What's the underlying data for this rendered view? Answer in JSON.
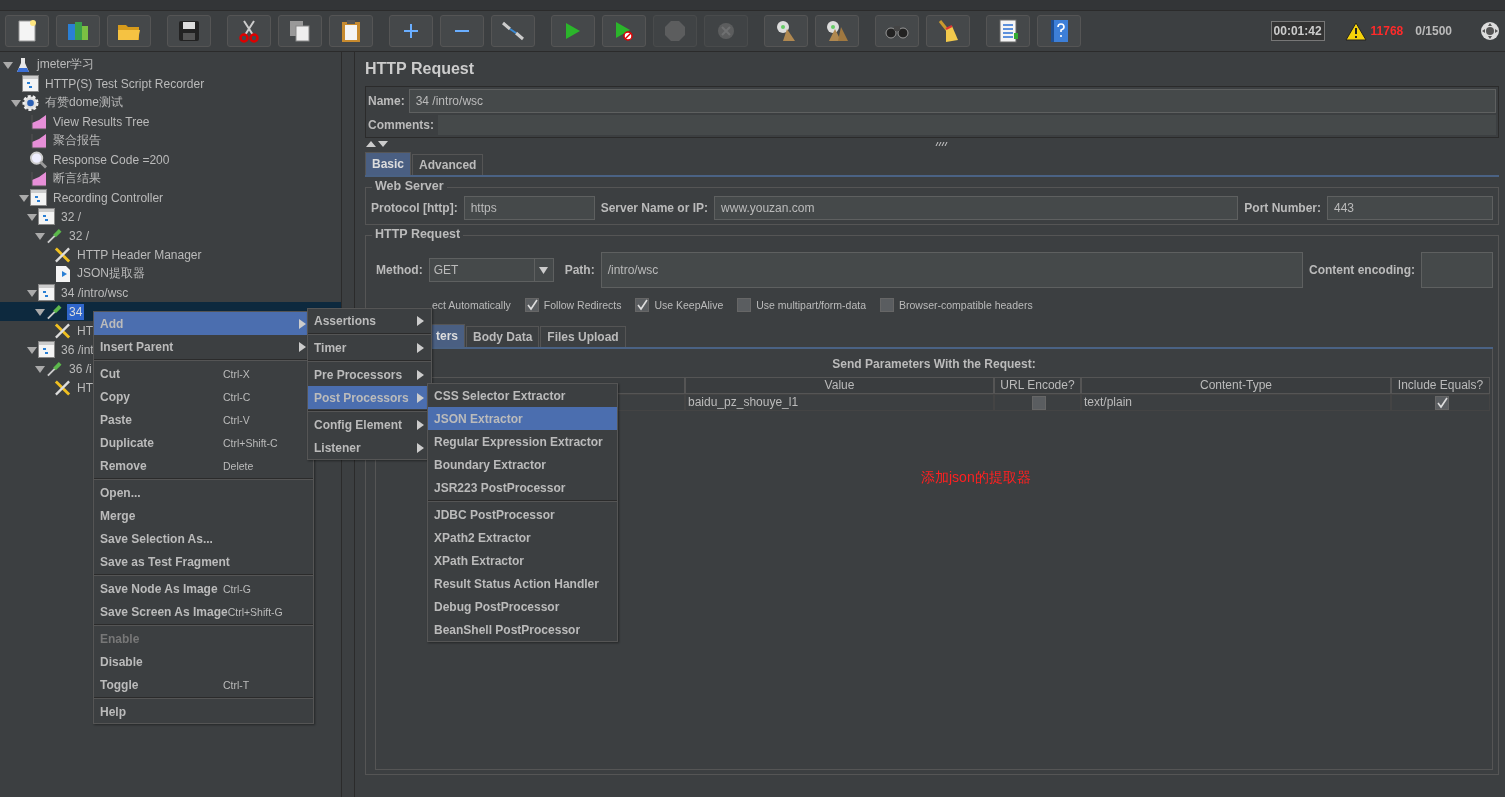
{
  "toolbar": [
    {
      "kind": "new",
      "disabled": false
    },
    {
      "kind": "templates",
      "disabled": false
    },
    {
      "kind": "open",
      "disabled": false
    },
    {
      "kind": "save",
      "disabled": false
    },
    {
      "kind": "cut",
      "disabled": false
    },
    {
      "kind": "copy",
      "disabled": false
    },
    {
      "kind": "paste",
      "disabled": false
    },
    {
      "kind": "add",
      "disabled": false
    },
    {
      "kind": "remove",
      "disabled": false
    },
    {
      "kind": "toggle",
      "disabled": false
    },
    {
      "kind": "start",
      "disabled": false
    },
    {
      "kind": "start_no_pause",
      "disabled": false
    },
    {
      "kind": "stop",
      "disabled": true
    },
    {
      "kind": "shutdown",
      "disabled": true
    },
    {
      "kind": "clear",
      "disabled": false
    },
    {
      "kind": "clear_all",
      "disabled": false
    },
    {
      "kind": "search",
      "disabled": false
    },
    {
      "kind": "reset_search",
      "disabled": false
    },
    {
      "kind": "function_helper",
      "disabled": false
    },
    {
      "kind": "help",
      "disabled": false
    }
  ],
  "status": {
    "timer": "00:01:42",
    "warnings": "11768",
    "threads": "0/1500"
  },
  "tree": [
    {
      "label": "jmeter学习",
      "kind": "test_plan",
      "expanded": true,
      "selected": false,
      "children": [
        {
          "label": "HTTP(S) Test Script Recorder",
          "kind": "recorder",
          "selected": false
        },
        {
          "label": "有赞dome测试",
          "kind": "thread_group",
          "expanded": true,
          "selected": false,
          "children": [
            {
              "label": "View Results Tree",
              "kind": "listener",
              "selected": false
            },
            {
              "label": "聚合报告",
              "kind": "listener",
              "selected": false
            },
            {
              "label": "Response Code =200",
              "kind": "assertion",
              "selected": false
            },
            {
              "label": "断言结果",
              "kind": "listener",
              "selected": false
            },
            {
              "label": "Recording Controller",
              "kind": "controller",
              "expanded": true,
              "selected": false,
              "children": [
                {
                  "label": "32 /",
                  "kind": "controller",
                  "expanded": true,
                  "selected": false,
                  "children": [
                    {
                      "label": "32 /",
                      "kind": "sampler",
                      "expanded": true,
                      "selected": false,
                      "children": [
                        {
                          "label": "HTTP Header Manager",
                          "kind": "config",
                          "selected": false
                        },
                        {
                          "label": "JSON提取器",
                          "kind": "extractor",
                          "selected": false
                        }
                      ]
                    }
                  ]
                },
                {
                  "label": "34 /intro/wsc",
                  "kind": "controller",
                  "expanded": true,
                  "selected": false,
                  "children": [
                    {
                      "label": "34",
                      "kind": "sampler",
                      "expanded": true,
                      "selected": true,
                      "children": [
                        {
                          "label": "HT",
                          "kind": "config",
                          "selected": false
                        }
                      ]
                    }
                  ]
                },
                {
                  "label": "36 /int",
                  "kind": "controller",
                  "expanded": true,
                  "selected": false,
                  "children": [
                    {
                      "label": "36 /i",
                      "kind": "sampler",
                      "expanded": true,
                      "selected": false,
                      "children": [
                        {
                          "label": "HT",
                          "kind": "config",
                          "selected": false
                        }
                      ]
                    }
                  ]
                }
              ]
            }
          ]
        }
      ]
    }
  ],
  "panel": {
    "title": "HTTP Request",
    "name_label": "Name:",
    "name_value": "34 /intro/wsc",
    "comments_label": "Comments:",
    "tabs": [
      {
        "label": "Basic",
        "selected": true
      },
      {
        "label": "Advanced",
        "selected": false
      }
    ],
    "web_server": {
      "legend": "Web Server",
      "protocol_label": "Protocol [http]:",
      "protocol": "https",
      "server_label": "Server Name or IP:",
      "server": "www.youzan.com",
      "port_label": "Port Number:",
      "port": "443"
    },
    "http_request": {
      "legend": "HTTP Request",
      "method_label": "Method:",
      "method": "GET",
      "path_label": "Path:",
      "path": "/intro/wsc",
      "encoding_label": "Content encoding:",
      "options": [
        {
          "label": "ect Automatically"
        },
        {
          "label": "Follow Redirects",
          "checked": true
        },
        {
          "label": "Use KeepAlive",
          "checked": true
        },
        {
          "label": "Use multipart/form-data",
          "checked": false
        },
        {
          "label": "Browser-compatible headers",
          "checked": false
        }
      ]
    },
    "inner_tabs": [
      {
        "label": "ters",
        "selected": true
      },
      {
        "label": "Body Data",
        "selected": false
      },
      {
        "label": "Files Upload",
        "selected": false
      }
    ],
    "params_title": "Send Parameters With the Request:",
    "columns": [
      "Value",
      "URL Encode?",
      "Content-Type",
      "Include Equals?"
    ],
    "rows": [
      {
        "value": "baidu_pz_shouye_l1",
        "url_encode": false,
        "content_type": "text/plain",
        "include_equals": true
      }
    ],
    "annotation": "添加json的提取器"
  },
  "context_menu": {
    "groups": [
      [
        {
          "label": "Add",
          "submenu": true,
          "selected": true,
          "disabled": false
        },
        {
          "label": "Insert Parent",
          "submenu": true,
          "selected": false,
          "disabled": false
        }
      ],
      [
        {
          "label": "Cut",
          "shortcut": "Ctrl-X",
          "selected": false,
          "disabled": false
        },
        {
          "label": "Copy",
          "shortcut": "Ctrl-C",
          "selected": false,
          "disabled": false
        },
        {
          "label": "Paste",
          "shortcut": "Ctrl-V",
          "selected": false,
          "disabled": false
        },
        {
          "label": "Duplicate",
          "shortcut": "Ctrl+Shift-C",
          "selected": false,
          "disabled": false
        },
        {
          "label": "Remove",
          "shortcut": "Delete",
          "selected": false,
          "disabled": false
        }
      ],
      [
        {
          "label": "Open...",
          "selected": false,
          "disabled": false
        },
        {
          "label": "Merge",
          "selected": false,
          "disabled": false
        },
        {
          "label": "Save Selection As...",
          "selected": false,
          "disabled": false
        },
        {
          "label": "Save as Test Fragment",
          "selected": false,
          "disabled": false
        }
      ],
      [
        {
          "label": "Save Node As Image",
          "shortcut": "Ctrl-G",
          "selected": false,
          "disabled": false
        },
        {
          "label": "Save Screen As Image",
          "shortcut": "Ctrl+Shift-G",
          "selected": false,
          "disabled": false
        }
      ],
      [
        {
          "label": "Enable",
          "selected": false,
          "disabled": true
        },
        {
          "label": "Disable",
          "selected": false,
          "disabled": false
        },
        {
          "label": "Toggle",
          "shortcut": "Ctrl-T",
          "selected": false,
          "disabled": false
        }
      ],
      [
        {
          "label": "Help",
          "selected": false,
          "disabled": false
        }
      ]
    ]
  },
  "add_menu": {
    "groups": [
      [
        {
          "label": "Assertions",
          "submenu": true,
          "selected": false
        }
      ],
      [
        {
          "label": "Timer",
          "submenu": true,
          "selected": false
        }
      ],
      [
        {
          "label": "Pre Processors",
          "submenu": true,
          "selected": false
        },
        {
          "label": "Post Processors",
          "submenu": true,
          "selected": true
        }
      ],
      [
        {
          "label": "Config Element",
          "submenu": true,
          "selected": false
        },
        {
          "label": "Listener",
          "submenu": true,
          "selected": false
        }
      ]
    ]
  },
  "post_processors_menu": {
    "groups": [
      [
        {
          "label": "CSS Selector Extractor",
          "selected": false
        },
        {
          "label": "JSON Extractor",
          "selected": true
        },
        {
          "label": "Regular Expression Extractor",
          "selected": false
        },
        {
          "label": "Boundary Extractor",
          "selected": false
        },
        {
          "label": "JSR223 PostProcessor",
          "selected": false
        }
      ],
      [
        {
          "label": "JDBC PostProcessor",
          "selected": false
        },
        {
          "label": "XPath2 Extractor",
          "selected": false
        },
        {
          "label": "XPath Extractor",
          "selected": false
        },
        {
          "label": "Result Status Action Handler",
          "selected": false
        },
        {
          "label": "Debug PostProcessor",
          "selected": false
        },
        {
          "label": "BeanShell PostProcessor",
          "selected": false
        }
      ]
    ]
  }
}
